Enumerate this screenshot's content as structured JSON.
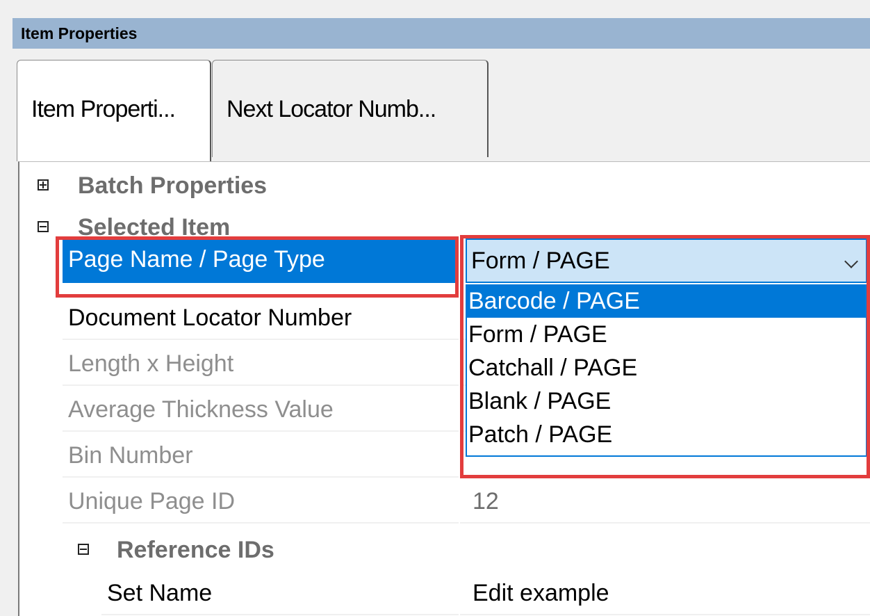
{
  "panel": {
    "title": "Item Properties"
  },
  "tabs": [
    {
      "label": "Item Properti..."
    },
    {
      "label": "Next Locator Numb..."
    }
  ],
  "grid": {
    "batch_properties": {
      "label": "Batch Properties",
      "expanded": false
    },
    "selected_item": {
      "label": "Selected Item",
      "expanded": true,
      "page_name": {
        "label": "Page Name / Page Type",
        "value": "Form / PAGE",
        "options": [
          "Barcode / PAGE",
          "Form / PAGE",
          "Catchall / PAGE",
          "Blank / PAGE",
          "Patch / PAGE"
        ],
        "highlighted_option": "Barcode / PAGE"
      },
      "rows": [
        {
          "label": "Document Locator Number",
          "value": ""
        },
        {
          "label": "Length x Height",
          "value": ""
        },
        {
          "label": "Average Thickness Value",
          "value": ""
        },
        {
          "label": "Bin Number",
          "value": ""
        },
        {
          "label": "Unique Page ID",
          "value": "12"
        }
      ],
      "reference_ids": {
        "label": "Reference IDs",
        "expanded": true,
        "rows": [
          {
            "label": "Set Name",
            "value": "Edit example"
          }
        ]
      }
    }
  },
  "colors": {
    "header_bg": "#99b4d1",
    "selection_blue": "#0078d7",
    "combo_bg": "#cce4f7",
    "callout_red": "#e23d3d"
  }
}
